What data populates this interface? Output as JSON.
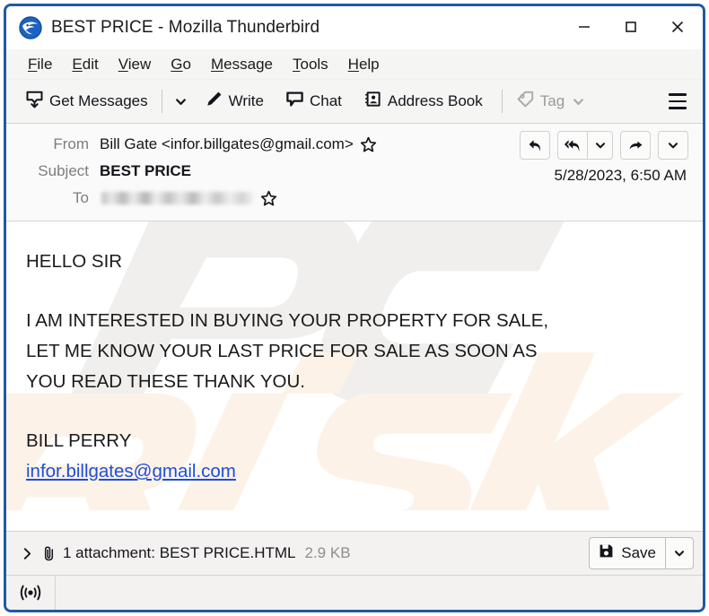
{
  "window": {
    "title": "BEST PRICE - Mozilla Thunderbird",
    "app_icon": "thunderbird-icon",
    "controls": {
      "minimize": "minimize-icon",
      "maximize": "maximize-icon",
      "close": "close-icon"
    }
  },
  "menu_bar": {
    "items": [
      {
        "label": "File",
        "access_key": "F"
      },
      {
        "label": "Edit",
        "access_key": "E"
      },
      {
        "label": "View",
        "access_key": "V"
      },
      {
        "label": "Go",
        "access_key": "G"
      },
      {
        "label": "Message",
        "access_key": "M"
      },
      {
        "label": "Tools",
        "access_key": "T"
      },
      {
        "label": "Help",
        "access_key": "H"
      }
    ]
  },
  "toolbar": {
    "get_messages_label": "Get Messages",
    "get_messages_icon": "get-messages-icon",
    "write_label": "Write",
    "write_icon": "pencil-icon",
    "chat_label": "Chat",
    "chat_icon": "chat-bubble-icon",
    "address_book_label": "Address Book",
    "address_book_icon": "address-book-icon",
    "tag_label": "Tag",
    "tag_icon": "tag-icon",
    "tag_disabled": true,
    "app_menu_icon": "hamburger-menu-icon"
  },
  "message_header": {
    "from_label": "From",
    "from_value": "Bill Gate <infor.billgates@gmail.com>",
    "subject_label": "Subject",
    "subject_value": "BEST PRICE",
    "to_label": "To",
    "to_value": "",
    "to_redacted": true,
    "date": "5/28/2023, 6:50 AM",
    "actions": {
      "reply": "reply-icon",
      "reply_all": "reply-all-icon",
      "reply_all_dropdown": "chevron-down-icon",
      "forward": "forward-icon",
      "more_dropdown": "chevron-down-icon"
    }
  },
  "message_body": {
    "lines": [
      "HELLO SIR",
      "",
      "I AM INTERESTED IN BUYING YOUR PROPERTY FOR SALE,",
      "LET ME KNOW YOUR LAST PRICE FOR SALE AS SOON AS",
      "YOU READ THESE THANK YOU.",
      "",
      "BILL PERRY"
    ],
    "email_link": "infor.billgates@gmail.com",
    "watermark": "PCrisk.com"
  },
  "attachment_bar": {
    "expand_icon": "chevron-right-icon",
    "clip_icon": "paperclip-icon",
    "label": "1 attachment: BEST PRICE.HTML",
    "size": "2.9 KB",
    "save_label": "Save",
    "save_icon": "save-disk-icon",
    "save_dropdown_icon": "chevron-down-icon"
  },
  "status_bar": {
    "online_icon": "online-status-icon"
  },
  "colors": {
    "window_border": "#1f5aa0",
    "chrome_background": "#f5f5f4",
    "link": "#1d4ed8",
    "muted_text": "#7d7d7d"
  }
}
